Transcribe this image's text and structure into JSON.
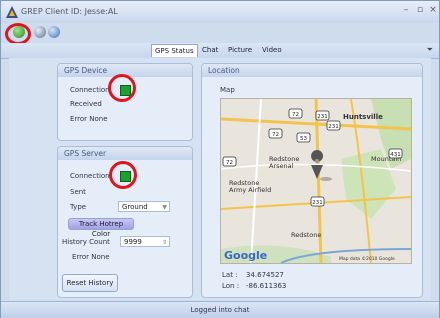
{
  "window": {
    "title": "GREP Client ID: Jesse:AL",
    "min_label": "–",
    "max_label": "▫",
    "close_label": "×"
  },
  "tabs": [
    {
      "label": "GPS Status"
    },
    {
      "label": "Chat"
    },
    {
      "label": "Picture"
    },
    {
      "label": "Video"
    }
  ],
  "gps_device": {
    "title": "GPS Device",
    "connection_label": "Connection",
    "received_label": "Received",
    "error_label": "Error None"
  },
  "gps_server": {
    "title": "GPS Server",
    "connection_label": "Connection",
    "sent_label": "Sent",
    "type_label": "Type",
    "type_value": "Ground",
    "track_button": "Track Hotrep Color",
    "history_count_label": "History Count",
    "history_count_value": "9999",
    "error_label": "Error None",
    "reset_button": "Reset History"
  },
  "location": {
    "title": "Location",
    "map_label": "Map",
    "lat_label": "Lat :",
    "lat_value": "34.674527",
    "lon_label": "Lon :",
    "lon_value": "-86.611363"
  },
  "map": {
    "place_huntsville": "Huntsville",
    "place_redstone_arsenal": "Redstone\nArsenal",
    "place_redstone_airfield": "Redstone\nArmy Airfield",
    "place_redstone": "Redstone",
    "place_mountain": "Mountain",
    "shields": [
      "72",
      "72",
      "231",
      "53",
      "72",
      "431",
      "231",
      "231"
    ],
    "google_logo": "Google",
    "copyright": "Map data ©2010 Google"
  },
  "status": {
    "text": "Logged into chat"
  },
  "colors": {
    "led_green": "#1fa02a",
    "annotation_red": "#e1141c"
  }
}
